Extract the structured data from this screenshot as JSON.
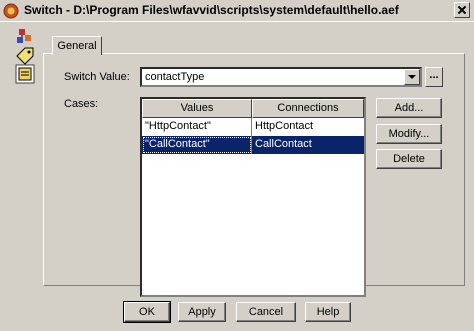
{
  "window": {
    "title": "Switch - D:\\Program Files\\wfavvid\\scripts\\system\\default\\hello.aef"
  },
  "sidebar": {
    "icons": [
      "switch-node-icon",
      "tag-icon",
      "document-icon"
    ]
  },
  "tabs": [
    {
      "label": "General",
      "active": true
    }
  ],
  "form": {
    "switch_value_label": "Switch Value:",
    "switch_value": "contactType",
    "ellipsis_label": "...",
    "cases_label": "Cases:"
  },
  "cases_table": {
    "columns": [
      "Values",
      "Connections"
    ],
    "rows": [
      {
        "value": "\"HttpContact\"",
        "connection": "HttpContact",
        "selected": false
      },
      {
        "value": "\"CallContact\"",
        "connection": "CallContact",
        "selected": true
      }
    ]
  },
  "side_buttons": {
    "add": "Add...",
    "modify": "Modify...",
    "delete": "Delete"
  },
  "footer_buttons": {
    "ok": "OK",
    "apply": "Apply",
    "cancel": "Cancel",
    "help": "Help"
  },
  "colors": {
    "selection": "#0a246a",
    "face": "#d4d0c8"
  }
}
